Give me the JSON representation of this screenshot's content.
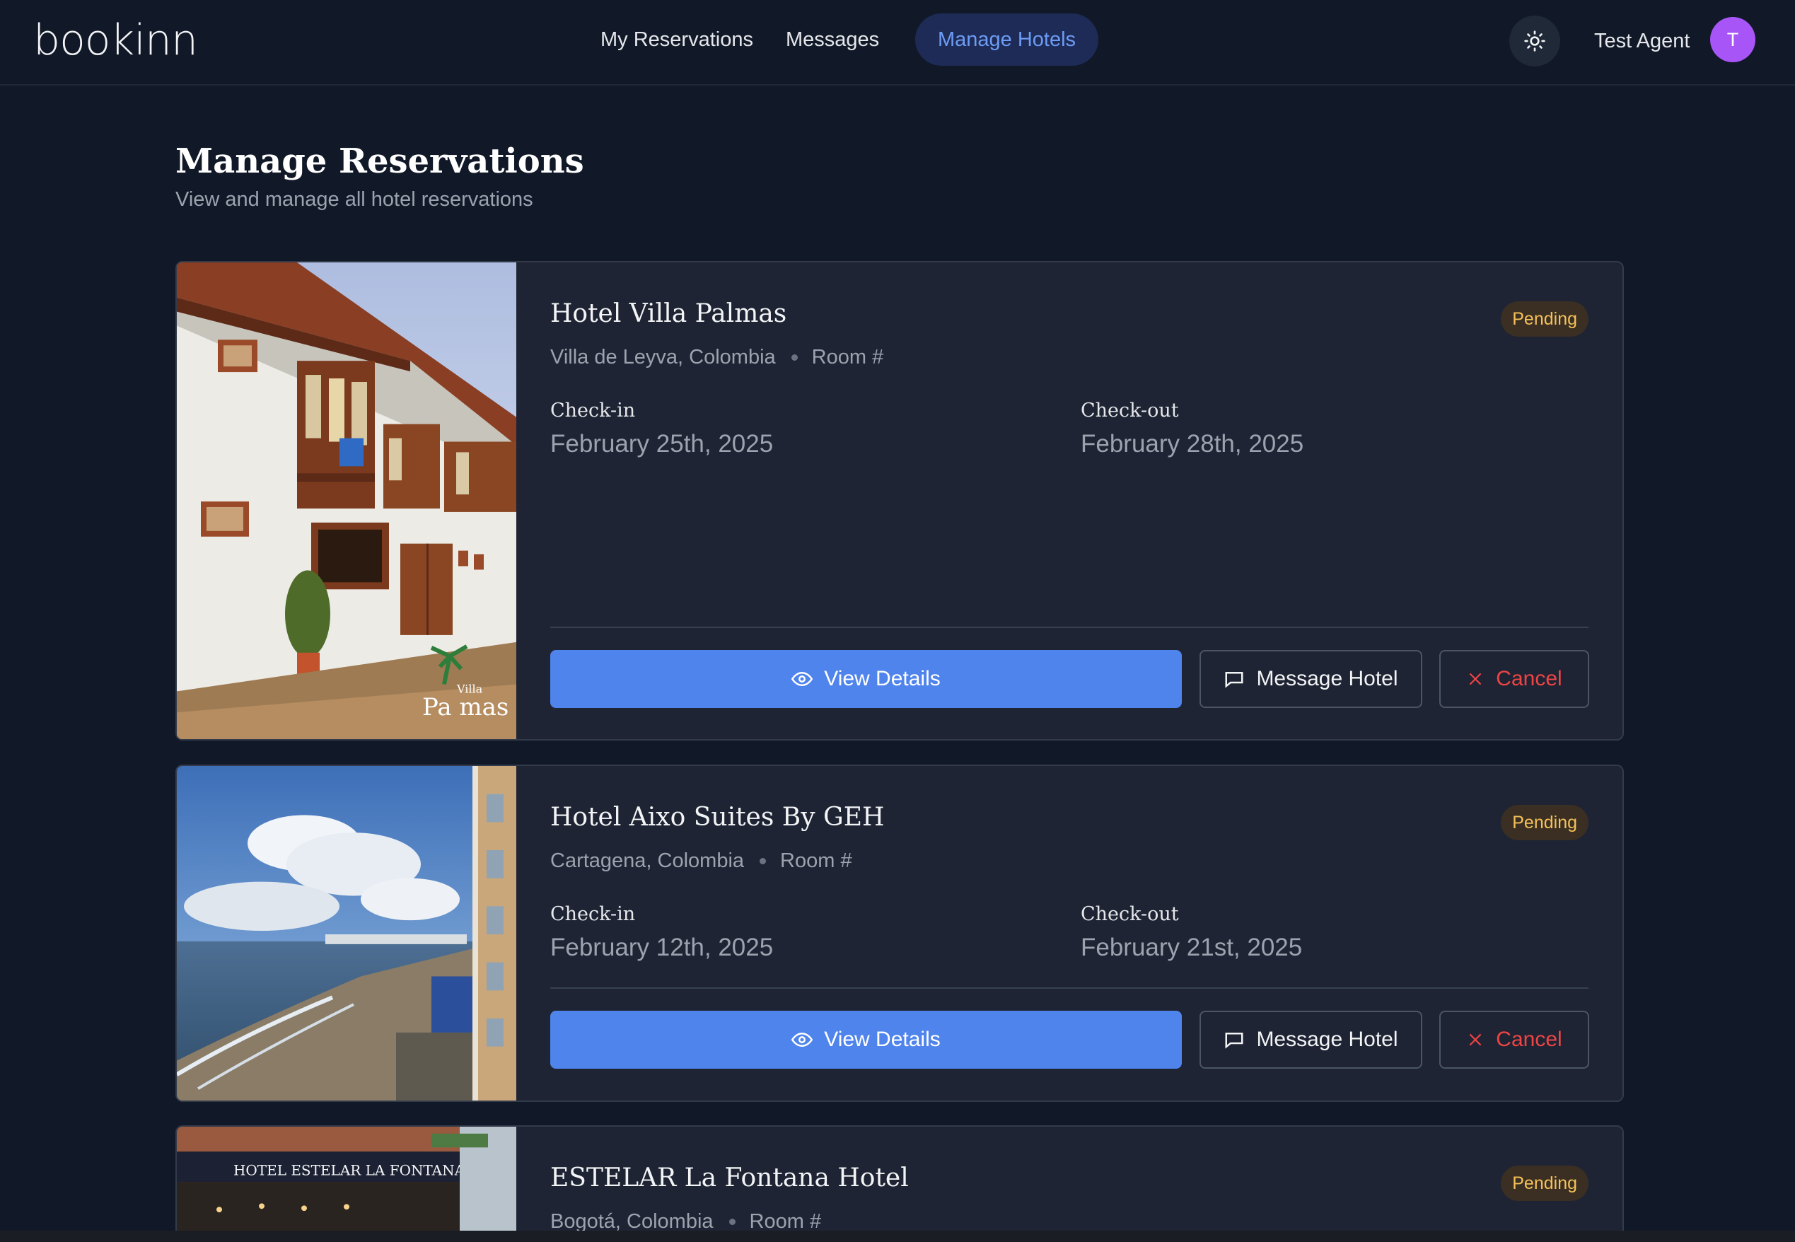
{
  "brand": {
    "logo": "bookinn"
  },
  "nav": {
    "links": [
      {
        "label": "My Reservations"
      },
      {
        "label": "Messages"
      },
      {
        "label": "Manage Hotels"
      }
    ]
  },
  "user": {
    "name": "Test Agent",
    "initial": "T"
  },
  "icons": {
    "theme": "sun-icon",
    "view": "eye-icon",
    "message": "chat-bubble-icon",
    "cancel": "x-icon"
  },
  "colors": {
    "accent": "#4f84ec",
    "pending": "#f5c05a",
    "cancel": "#ef4444",
    "avatar": "#a855f7"
  },
  "page": {
    "title": "Manage Reservations",
    "subtitle": "View and manage all hotel reservations"
  },
  "reservations": [
    {
      "hotel": "Hotel Villa Palmas",
      "status": "Pending",
      "location": "Villa de Leyva, Colombia",
      "room": "Room #",
      "checkin_label": "Check-in",
      "checkin": "February 25th, 2025",
      "checkout_label": "Check-out",
      "checkout": "February 28th, 2025",
      "image_text": "Pa mas",
      "image_text_small": "Villa",
      "view_label": "View Details",
      "message_label": "Message Hotel",
      "cancel_label": "Cancel"
    },
    {
      "hotel": "Hotel Aixo Suites By GEH",
      "status": "Pending",
      "location": "Cartagena, Colombia",
      "room": "Room #",
      "checkin_label": "Check-in",
      "checkin": "February 12th, 2025",
      "checkout_label": "Check-out",
      "checkout": "February 21st, 2025",
      "view_label": "View Details",
      "message_label": "Message Hotel",
      "cancel_label": "Cancel"
    },
    {
      "hotel": "ESTELAR La Fontana Hotel",
      "status": "Pending",
      "location": "Bogotá, Colombia",
      "room": "Room #",
      "image_text": "HOTEL ESTELAR LA FONTANA"
    }
  ]
}
